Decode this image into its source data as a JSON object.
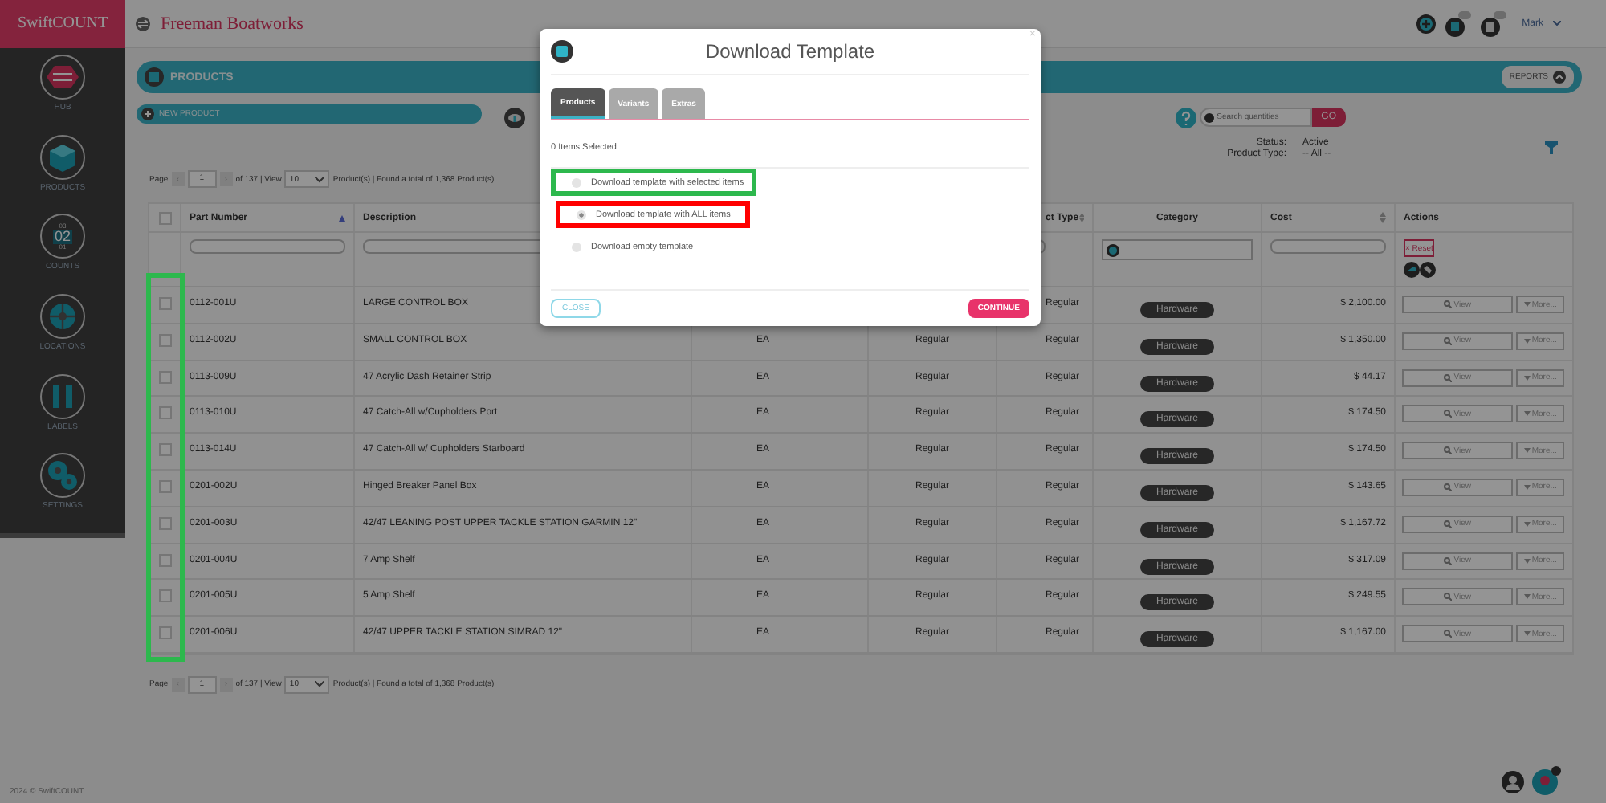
{
  "brand": "SwiftCOUNT",
  "company": "Freeman Boatworks",
  "user": "Mark",
  "sidebar": [
    {
      "label": "HUB",
      "kind": "hub"
    },
    {
      "label": "PRODUCTS",
      "kind": "products"
    },
    {
      "label": "COUNTS",
      "kind": "counts",
      "digits": [
        "03",
        "02",
        "01"
      ]
    },
    {
      "label": "LOCATIONS",
      "kind": "locations"
    },
    {
      "label": "LABELS",
      "kind": "labels"
    },
    {
      "label": "SETTINGS",
      "kind": "settings"
    }
  ],
  "page_title": "PRODUCTS",
  "reports_button": "REPORTS",
  "new_product_button": "NEW PRODUCT",
  "search": {
    "placeholder": "Search quantities",
    "button": "GO"
  },
  "filters": [
    {
      "label": "Status:",
      "value": "Active"
    },
    {
      "label": "Product Type:",
      "value": "-- All --"
    }
  ],
  "pagination_top": {
    "page_label": "Page",
    "prev": "‹",
    "page": "1",
    "next": "›",
    "of": "of 137 | View",
    "per_page": "10",
    "summary": "Product(s) | Found a total of 1,368 Product(s)"
  },
  "table": {
    "select_all": {
      "checked": false
    },
    "highlight": {
      "color": "#2db84d"
    },
    "columns": [
      {
        "label": "Part Number"
      },
      {
        "label": "Description"
      },
      {
        "label": "ct Type"
      },
      {
        "label": "Category"
      },
      {
        "label": "Cost"
      },
      {
        "label": "Actions"
      }
    ],
    "reset_button": "× Reset",
    "rows": [
      {
        "checked": false,
        "part": "0112-001U",
        "description": "LARGE CONTROL BOX",
        "type": "Regular",
        "category": "Hardware",
        "cost": "$ 2,100.00",
        "view": "View",
        "more": "More..."
      },
      {
        "checked": false,
        "part": "0112-002U",
        "description": "SMALL CONTROL BOX",
        "uom": "EA",
        "column_5": "Regular",
        "type": "Regular",
        "category": "Hardware",
        "cost": "$ 1,350.00",
        "view": "View",
        "more": "More..."
      },
      {
        "checked": false,
        "part": "0113-009U",
        "description": "47 Acrylic Dash Retainer Strip",
        "uom": "EA",
        "column_5": "Regular",
        "type": "Regular",
        "category": "Hardware",
        "cost": "$ 44.17",
        "view": "View",
        "more": "More..."
      },
      {
        "checked": false,
        "part": "0113-010U",
        "description": "47 Catch-All w/Cupholders Port",
        "uom": "EA",
        "column_5": "Regular",
        "type": "Regular",
        "category": "Hardware",
        "cost": "$ 174.50",
        "view": "View",
        "more": "More..."
      },
      {
        "checked": false,
        "part": "0113-014U",
        "description": "47 Catch-All w/ Cupholders Starboard",
        "uom": "EA",
        "column_5": "Regular",
        "type": "Regular",
        "category": "Hardware",
        "cost": "$ 174.50",
        "view": "View",
        "more": "More..."
      },
      {
        "checked": false,
        "part": "0201-002U",
        "description": "Hinged Breaker Panel Box",
        "uom": "EA",
        "column_5": "Regular",
        "type": "Regular",
        "category": "Hardware",
        "cost": "$ 143.65",
        "view": "View",
        "more": "More..."
      },
      {
        "checked": false,
        "part": "0201-003U",
        "description": "42/47 LEANING POST UPPER TACKLE STATION GARMIN 12\"",
        "uom": "EA",
        "column_5": "Regular",
        "type": "Regular",
        "category": "Hardware",
        "cost": "$ 1,167.72",
        "view": "View",
        "more": "More..."
      },
      {
        "checked": false,
        "part": "0201-004U",
        "description": "7 Amp Shelf",
        "uom": "EA",
        "column_5": "Regular",
        "type": "Regular",
        "category": "Hardware",
        "cost": "$ 317.09",
        "view": "View",
        "more": "More..."
      },
      {
        "checked": false,
        "part": "0201-005U",
        "description": "5 Amp Shelf",
        "uom": "EA",
        "column_5": "Regular",
        "type": "Regular",
        "category": "Hardware",
        "cost": "$ 249.55",
        "view": "View",
        "more": "More..."
      },
      {
        "checked": false,
        "part": "0201-006U",
        "description": "42/47 UPPER TACKLE STATION SIMRAD 12\"",
        "uom": "EA",
        "column_5": "Regular",
        "type": "Regular",
        "category": "Hardware",
        "cost": "$ 1,167.00",
        "view": "View",
        "more": "More..."
      }
    ]
  },
  "pagination_bottom": {
    "page_label": "Page",
    "prev": "‹",
    "page": "1",
    "next": "›",
    "of": "of 137 | View",
    "per_page": "10",
    "summary": "Product(s) | Found a total of 1,368 Product(s)"
  },
  "footer": "2024 © SwiftCOUNT",
  "modal": {
    "title": "Download Template",
    "close": "×",
    "tabs": [
      {
        "label": "Products",
        "selected": true
      },
      {
        "label": "Variants",
        "selected": false
      },
      {
        "label": "Extras",
        "selected": false
      }
    ],
    "selection_info": "0 Items Selected",
    "options": [
      {
        "label": "Download template with selected items",
        "selected": false,
        "color": "#2db84d"
      },
      {
        "label": "Download template with ALL items",
        "selected": true,
        "color": "#ff0000"
      },
      {
        "label": "Download empty template",
        "selected": false
      }
    ],
    "close_button": "CLOSE",
    "continue_button": "CONTINUE"
  }
}
